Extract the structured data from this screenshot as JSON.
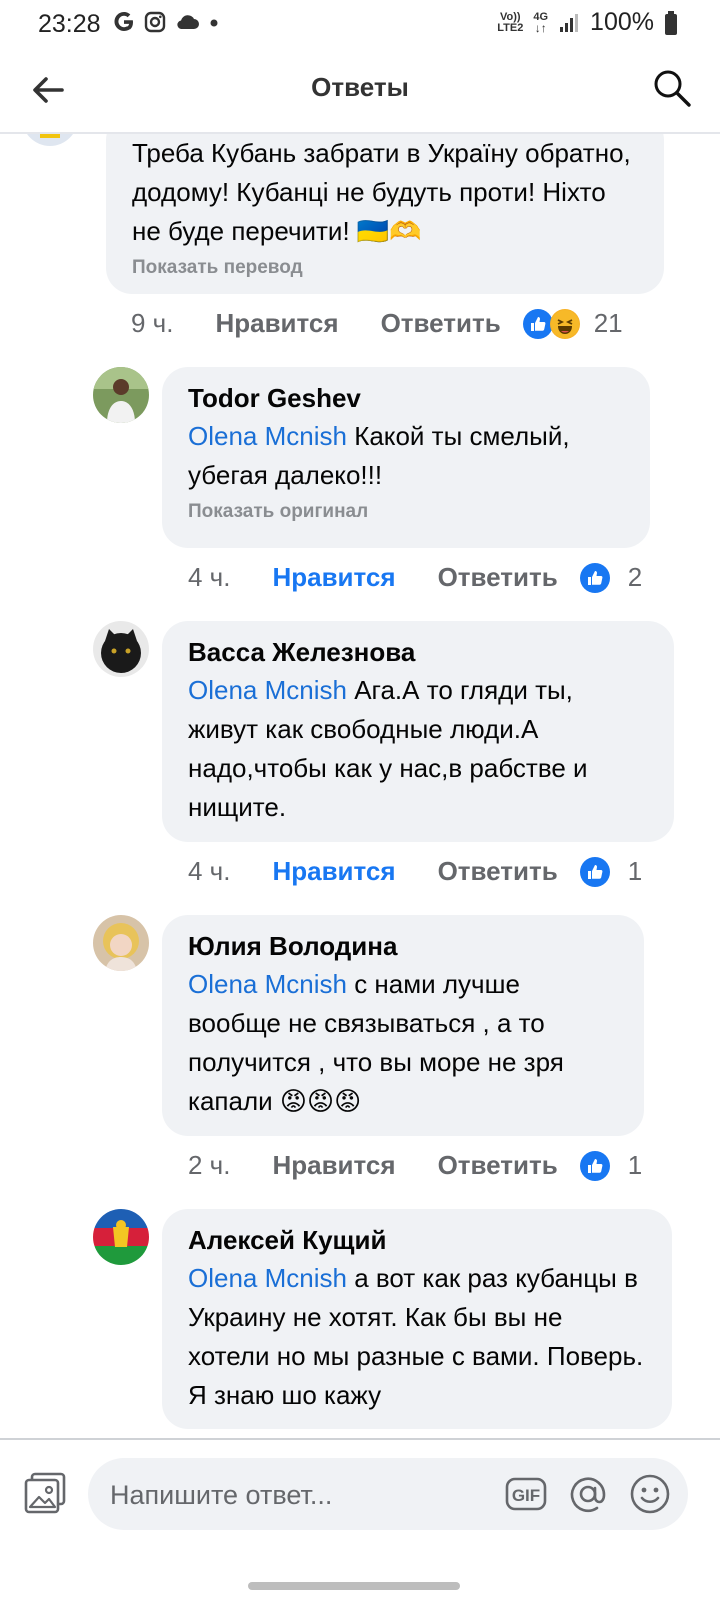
{
  "status_bar": {
    "time": "23:28",
    "volte": "Vo))",
    "lte": "LTE2",
    "net": "4G",
    "battery": "100%"
  },
  "header": {
    "title": "Ответы"
  },
  "comments": [
    {
      "author": "",
      "mention": "",
      "text": "Треба Кубань забрати в Україну обратно, додому!  Кубанці не будуть проти! Ніхто не буде перечити! 🇺🇦🫶",
      "translate_link": "Показать перевод",
      "time": "9 ч.",
      "like_label": "Нравится",
      "reply_label": "Ответить",
      "reactions_count": "21"
    },
    {
      "author": "Todor Geshev",
      "mention": "Olena Mcnish",
      "text": "Какой ты смелый, убегая далеко!!!",
      "translate_link": "Показать оригинал",
      "time": "4 ч.",
      "like_label": "Нравится",
      "reply_label": "Ответить",
      "reactions_count": "2"
    },
    {
      "author": "Васса Железнова",
      "mention": "Olena Mcnish",
      "text": "Ага.А то гляди ты, живут как свободные люди.А надо,чтобы как у нас,в рабстве и нищите.",
      "time": "4 ч.",
      "like_label": "Нравится",
      "reply_label": "Ответить",
      "reactions_count": "1"
    },
    {
      "author": "Юлия Володина",
      "mention": "Olena Mcnish",
      "text": "с нами лучше вообще не связываться , а то получится , что вы море не зря капали 😡😡😡",
      "time": "2 ч.",
      "like_label": "Нравится",
      "reply_label": "Ответить",
      "reactions_count": "1"
    },
    {
      "author": "Алексей Кущий",
      "mention": "Olena Mcnish",
      "text": "а вот как раз кубанцы в Украину не хотят. Как бы вы не хотели но мы разные с вами. Поверь. Я знаю шо кажу"
    }
  ],
  "composer": {
    "placeholder": "Напишите ответ...",
    "gif_label": "GIF"
  },
  "colors": {
    "accent": "#1877f2",
    "mention": "#1a6fd6",
    "bubble": "#f0f2f5"
  }
}
